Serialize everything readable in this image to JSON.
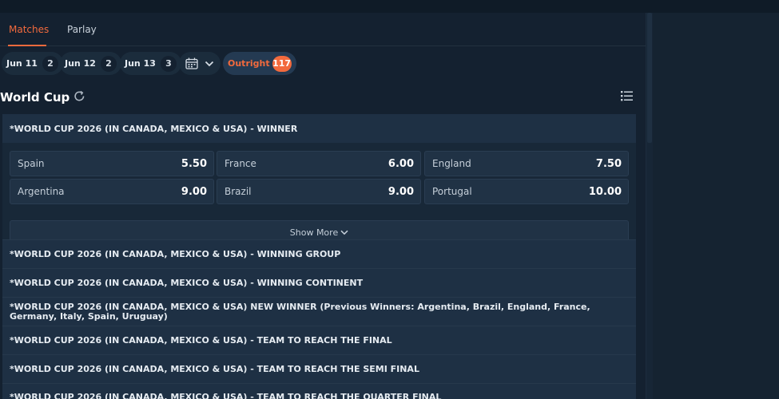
{
  "tabs": [
    {
      "label": "Matches",
      "active": true
    },
    {
      "label": "Parlay",
      "active": false
    }
  ],
  "date_chips": [
    {
      "label": "Jun 11",
      "count": "2"
    },
    {
      "label": "Jun 12",
      "count": "2"
    },
    {
      "label": "Jun 13",
      "count": "3"
    }
  ],
  "calendar_icon": "calendar-icon",
  "outright": {
    "label": "Outright",
    "count": "117"
  },
  "section": {
    "title": "World Cup"
  },
  "expanded_market": {
    "title": "*WORLD CUP 2026 (IN CANADA, MEXICO & USA) - WINNER",
    "selections": [
      {
        "name": "Spain",
        "odds": "5.50"
      },
      {
        "name": "France",
        "odds": "6.00"
      },
      {
        "name": "England",
        "odds": "7.50"
      },
      {
        "name": "Argentina",
        "odds": "9.00"
      },
      {
        "name": "Brazil",
        "odds": "9.00"
      },
      {
        "name": "Portugal",
        "odds": "10.00"
      }
    ],
    "show_more_label": "Show More"
  },
  "markets": [
    "*WORLD CUP 2026 (IN CANADA, MEXICO & USA) - WINNING GROUP",
    "*WORLD CUP 2026 (IN CANADA, MEXICO & USA) - WINNING CONTINENT",
    "*WORLD CUP 2026 (IN CANADA, MEXICO & USA) NEW WINNER (Previous Winners: Argentina, Brazil, England, France, Germany, Italy, Spain, Uruguay)",
    "*WORLD CUP 2026 (IN CANADA, MEXICO & USA) - TEAM TO REACH THE FINAL",
    "*WORLD CUP 2026 (IN CANADA, MEXICO & USA) - TEAM TO REACH THE SEMI FINAL",
    "*WORLD CUP 2026 (IN CANADA, MEXICO & USA) - TEAM TO REACH THE QUARTER FINAL"
  ],
  "colors": {
    "accent": "#f26a3d",
    "background": "#142130",
    "card": "#1e3044"
  }
}
